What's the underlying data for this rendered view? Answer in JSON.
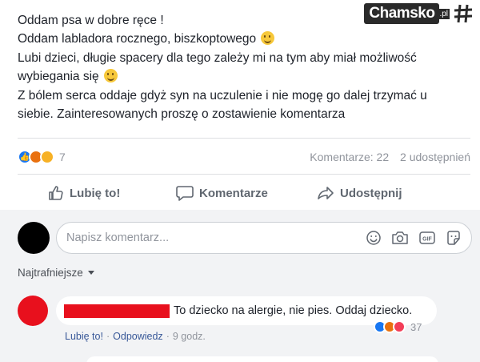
{
  "watermark": {
    "brand": "Chamsko",
    "tld": ".pl"
  },
  "post": {
    "lines": [
      "Oddam psa w dobre ręce !",
      "Oddam labladora rocznego, biszkoptowego",
      "Lubi dzieci, długie spacery dla tego zależy mi na tym aby miał możliwość",
      "wybiegania się",
      "Z bólem serca oddaje gdyż syn na uczulenie i nie mogę go dalej trzymać u",
      "siebie. Zainteresowanych proszę o zostawienie komentarza"
    ],
    "reactions_count": "7",
    "comments_stat": "Komentarze: 22",
    "shares_stat": "2 udostępnień",
    "reaction_icons": [
      "like-icon",
      "angry-icon",
      "sad-icon"
    ]
  },
  "actions": {
    "like": "Lubię to!",
    "comment": "Komentarze",
    "share": "Udostępnij"
  },
  "composer": {
    "placeholder": "Napisz komentarz...",
    "icons": [
      "emoji-icon",
      "camera-icon",
      "gif-icon",
      "sticker-icon"
    ]
  },
  "sort": {
    "label": "Najtrafniejsze"
  },
  "comment": {
    "text": "To dziecko na alergie, nie pies. Oddaj dziecko.",
    "reactions_count": "37",
    "like_label": "Lubię to!",
    "reply_label": "Odpowiedz",
    "time": "9 godz.",
    "reaction_icons": [
      "like-icon",
      "angry-icon",
      "love-icon"
    ]
  },
  "colors": {
    "brand_blue": "#1877f2",
    "link_blue": "#385898",
    "redaction_red": "#e8101d",
    "comment_bg": "#f2f3f5"
  }
}
